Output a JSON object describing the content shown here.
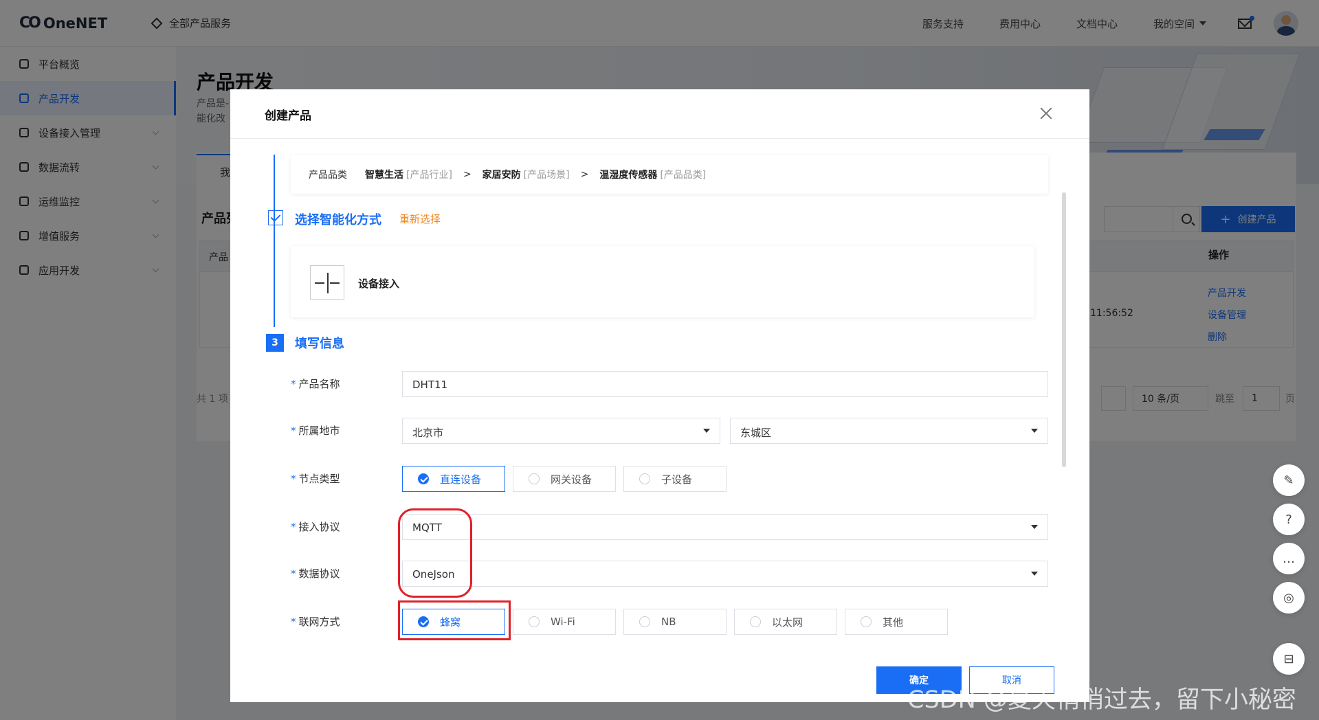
{
  "topbar": {
    "logo_mark": "CO",
    "logo_text": "OneNET",
    "all_products": "全部产品服务",
    "nav": [
      "服务支持",
      "费用中心",
      "文档中心"
    ],
    "my_space": "我的空间"
  },
  "sidebar": {
    "items": [
      {
        "label": "平台概览"
      },
      {
        "label": "产品开发"
      },
      {
        "label": "设备接入管理"
      },
      {
        "label": "数据流转"
      },
      {
        "label": "运维监控"
      },
      {
        "label": "增值服务"
      },
      {
        "label": "应用开发"
      }
    ]
  },
  "background": {
    "page_title": "产品开发",
    "desc_line1": "产品是-",
    "desc_line2": "能化改",
    "tab_partial": "我",
    "section_partial": "产品列",
    "col_partial": "产品",
    "ops_header": "操作",
    "ops": [
      "产品开发",
      "设备管理",
      "删除"
    ],
    "time_partial": "11:56:52",
    "total_partial": "共 1 项",
    "create_button": "创建产品",
    "page_size": "10 条/页",
    "jump_label": "跳至",
    "jump_value": "1",
    "page_unit": "页"
  },
  "modal": {
    "title": "创建产品",
    "summary": {
      "label": "产品品类",
      "industry": "智慧生活",
      "industry_tag": "[产品行业]",
      "scene": "家居安防",
      "scene_tag": "[产品场景]",
      "category": "温湿度传感器",
      "category_tag": "[产品品类]",
      "sep": ">"
    },
    "step2": {
      "title": "选择智能化方式",
      "reselect": "重新选择",
      "mode_label": "设备接入"
    },
    "step3": {
      "number": "3",
      "title": "填写信息"
    },
    "form": {
      "product_name_label": "产品名称",
      "product_name_value": "DHT11",
      "region_label": "所属地市",
      "city": "北京市",
      "district": "东城区",
      "node_type_label": "节点类型",
      "node_types": [
        "直连设备",
        "网关设备",
        "子设备"
      ],
      "protocol_label": "接入协议",
      "protocol_value": "MQTT",
      "data_protocol_label": "数据协议",
      "data_protocol_value": "OneJson",
      "network_label": "联网方式",
      "networks": [
        "蜂窝",
        "Wi-Fi",
        "NB",
        "以太网",
        "其他"
      ]
    },
    "confirm": "确定",
    "cancel": "取消"
  },
  "watermark": "CSDN @夏天悄悄过去，留下小秘密",
  "colors": {
    "accent": "#1a6ef5",
    "highlight": "#e0202a",
    "reselect": "#f08a24"
  }
}
